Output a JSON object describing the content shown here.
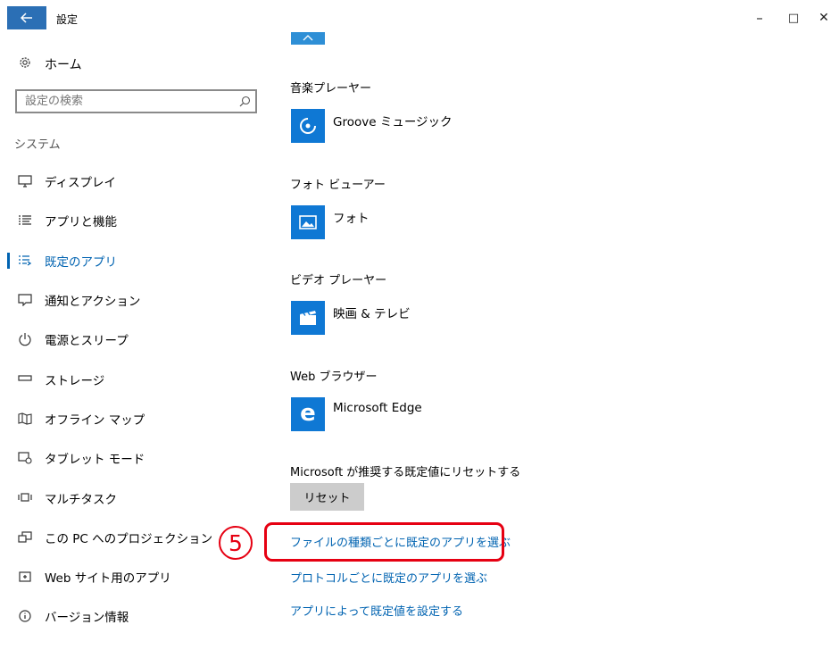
{
  "window": {
    "title": "設定",
    "controls": {
      "minimize": "–",
      "maximize": "□",
      "close": "✕"
    }
  },
  "sidebar": {
    "home_label": "ホーム",
    "search_placeholder": "設定の検索",
    "section_header": "システム",
    "items": [
      {
        "label": "ディスプレイ",
        "icon": "monitor-icon"
      },
      {
        "label": "アプリと機能",
        "icon": "list-icon"
      },
      {
        "label": "既定のアプリ",
        "icon": "default-apps-icon",
        "active": true
      },
      {
        "label": "通知とアクション",
        "icon": "notification-icon"
      },
      {
        "label": "電源とスリープ",
        "icon": "power-icon"
      },
      {
        "label": "ストレージ",
        "icon": "storage-icon"
      },
      {
        "label": "オフライン マップ",
        "icon": "map-icon"
      },
      {
        "label": "タブレット モード",
        "icon": "tablet-icon"
      },
      {
        "label": "マルチタスク",
        "icon": "multitask-icon"
      },
      {
        "label": "この PC へのプロジェクション",
        "icon": "projection-icon"
      },
      {
        "label": "Web サイト用のアプリ",
        "icon": "web-apps-icon"
      },
      {
        "label": "バージョン情報",
        "icon": "info-icon"
      }
    ]
  },
  "main": {
    "groups": [
      {
        "title": "音楽プレーヤー",
        "app": "Groove ミュージック",
        "icon": "groove-icon"
      },
      {
        "title": "フォト ビューアー",
        "app": "フォト",
        "icon": "photos-icon"
      },
      {
        "title": "ビデオ プレーヤー",
        "app": "映画 & テレビ",
        "icon": "movies-icon"
      },
      {
        "title": "Web ブラウザー",
        "app": "Microsoft Edge",
        "icon": "edge-icon"
      }
    ],
    "reset_text": "Microsoft が推奨する既定値にリセットする",
    "reset_button": "リセット",
    "links": [
      "ファイルの種類ごとに既定のアプリを選ぶ",
      "プロトコルごとに既定のアプリを選ぶ",
      "アプリによって既定値を設定する"
    ]
  },
  "annotation": {
    "step_number": "5"
  },
  "colors": {
    "accent": "#0078d7",
    "link": "#0063b1",
    "highlight": "#e60012",
    "back": "#2b6fb5"
  }
}
